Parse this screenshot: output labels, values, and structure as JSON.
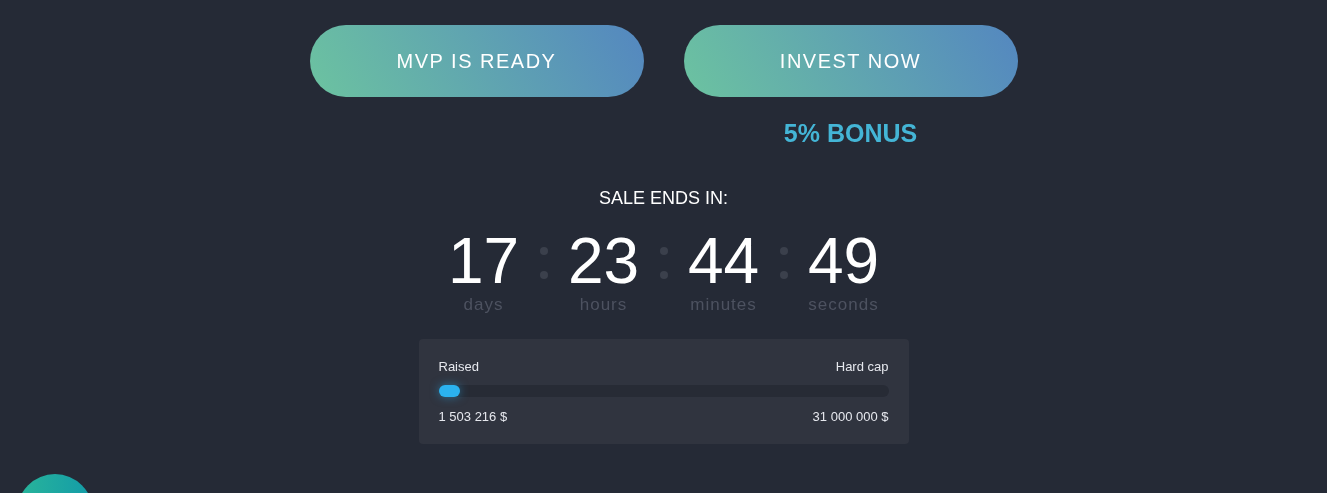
{
  "buttons": [
    {
      "label": "MVP IS READY"
    },
    {
      "label": "INVEST NOW"
    }
  ],
  "bonus": "5% BONUS",
  "countdown": {
    "title": "SALE ENDS IN:",
    "units": [
      {
        "value": "17",
        "label": "days"
      },
      {
        "value": "23",
        "label": "hours"
      },
      {
        "value": "44",
        "label": "minutes"
      },
      {
        "value": "49",
        "label": "seconds"
      }
    ]
  },
  "progress": {
    "left_label": "Raised",
    "right_label": "Hard cap",
    "level": 0.048,
    "raised": "1 503 216 $",
    "hard_cap": "31 000 000 $"
  }
}
